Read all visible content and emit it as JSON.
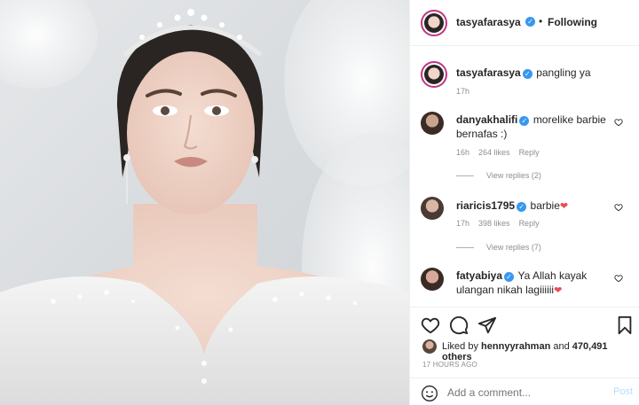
{
  "post": {
    "author": "tasyafarasya",
    "follow_separator": "•",
    "follow_status": "Following",
    "caption_author": "tasyafarasya",
    "caption": "pangling ya",
    "caption_time": "17h"
  },
  "comments": [
    {
      "user": "danyakhalifi",
      "line1": "morelike barbie",
      "line2": "bernafas :)",
      "time": "16h",
      "likes": "264 likes",
      "reply": "Reply",
      "view_replies": "View replies (2)"
    },
    {
      "user": "riaricis1795",
      "text": "barbie",
      "heart": "❤",
      "time": "17h",
      "likes": "398 likes",
      "reply": "Reply",
      "view_replies": "View replies (7)"
    },
    {
      "user": "fatyabiya",
      "line1": "Ya Allah kayak",
      "line2": "ulangan nikah lagiiiiii",
      "heart": "❤"
    }
  ],
  "likes": {
    "prefix": "Liked by",
    "user": "hennyyrahman",
    "middle": "and",
    "count": "470,491 others"
  },
  "timestamp": "17 HOURS AGO",
  "add_comment": {
    "placeholder": "Add a comment...",
    "post_label": "Post"
  },
  "icons": {
    "verified": "verified-badge-icon",
    "like": "heart-outline-icon",
    "comment": "speech-bubble-icon",
    "share": "paper-plane-icon",
    "save": "bookmark-icon",
    "emoji": "smiley-icon"
  },
  "colors": {
    "accent_blue": "#3897f0",
    "heart_red": "#ed4956",
    "post_disabled": "#b2dffc",
    "muted_text": "#8e8e8e"
  }
}
